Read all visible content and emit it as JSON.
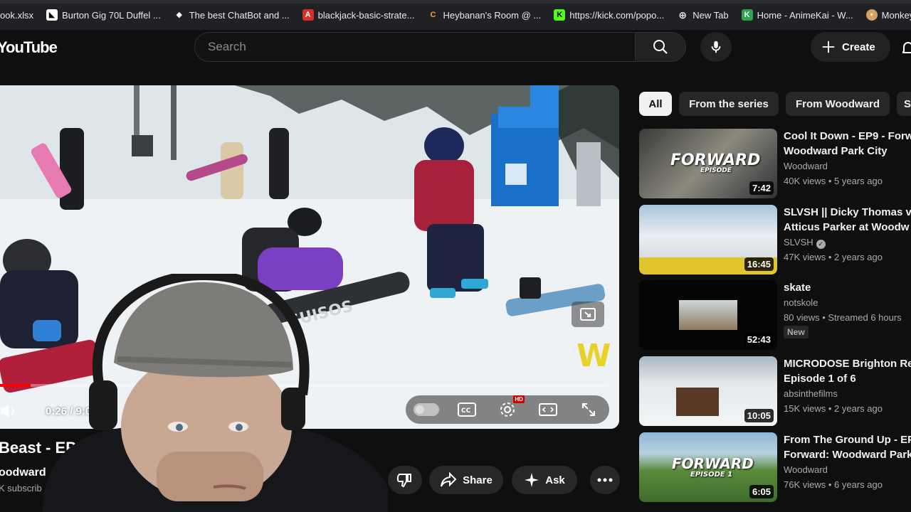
{
  "bookmarks": [
    {
      "label": "ook.xlsx",
      "icon": "excel-icon",
      "color": "#1d6f42"
    },
    {
      "label": "Burton Gig 70L Duffel ...",
      "icon": "burton-icon",
      "color": "#ffffff"
    },
    {
      "label": "The best ChatBot and ...",
      "icon": "chatbot-icon",
      "color": "#ffffff"
    },
    {
      "label": "blackjack-basic-strate...",
      "icon": "pdf-icon",
      "color": "#d93025"
    },
    {
      "label": "Heybanan's Room @ ...",
      "icon": "chaturbate-icon",
      "color": "#f0a030"
    },
    {
      "label": "https://kick.com/popo...",
      "icon": "kick-icon",
      "color": "#53fc18"
    },
    {
      "label": "New Tab",
      "icon": "globe-icon",
      "color": "#e8eaed"
    },
    {
      "label": "Home - AnimeKai - W...",
      "icon": "animekai-icon",
      "color": "#2ea44f"
    },
    {
      "label": "Monkey: Free Rando",
      "icon": "monkey-icon",
      "color": "#d9a066"
    }
  ],
  "masthead": {
    "logo": "YouTube",
    "search_placeholder": "Search",
    "create_label": "Create"
  },
  "player": {
    "time": "0:26 / 9:0",
    "progress": 0.05,
    "brand_mark": "W"
  },
  "video": {
    "title": "Beast - EPS",
    "channel": "oodward",
    "subscribers": "K subscrib",
    "share_label": "Share",
    "ask_label": "Ask"
  },
  "chips": [
    "All",
    "From the series",
    "From Woodward",
    "S"
  ],
  "recommendations": [
    {
      "title": "Cool It Down - EP9 - Forw",
      "title2": "Woodward Park City",
      "channel": "Woodward",
      "meta": "40K views • 5 years ago",
      "duration": "7:42",
      "overlay": "FORWARD",
      "overlay_sub": "EPISODE"
    },
    {
      "title": "SLVSH || Dicky Thomas v",
      "title2": "Atticus Parker at Woodw",
      "channel": "SLVSH",
      "meta": "47K views • 2 years ago",
      "duration": "16:45"
    },
    {
      "title": "skate",
      "title2": "",
      "channel": "notskole",
      "meta": "80 views • Streamed 6 hours",
      "duration": "52:43",
      "badge": "New"
    },
    {
      "title": "MICRODOSE Brighton Re",
      "title2": "Episode 1 of 6",
      "channel": "absinthefilms",
      "meta": "15K views • 2 years ago",
      "duration": "10:05"
    },
    {
      "title": "From The Ground Up - EP",
      "title2": "Forward: Woodward Park",
      "channel": "Woodward",
      "meta": "76K views • 6 years ago",
      "duration": "6:05",
      "overlay": "FORWARD",
      "overlay_sub": "EPISODE 1"
    }
  ]
}
